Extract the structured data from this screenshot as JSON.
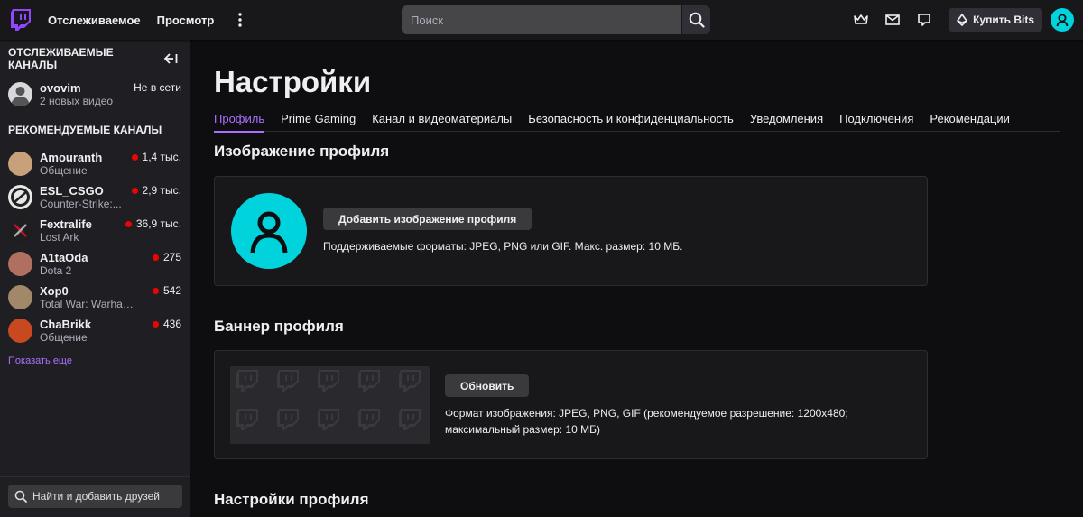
{
  "topnav": {
    "following": "Отслеживаемое",
    "browse": "Просмотр",
    "search_placeholder": "Поиск",
    "buy_bits": "Купить Bits"
  },
  "sidebar": {
    "followed_title": "ОТСЛЕЖИВАЕМЫЕ КАНАЛЫ",
    "followed": [
      {
        "name": "ovovim",
        "sub": "2 новых видео",
        "status": "Не в сети"
      }
    ],
    "recommended_title": "РЕКОМЕНДУЕМЫЕ КАНАЛЫ",
    "recommended": [
      {
        "name": "Amouranth",
        "game": "Общение",
        "viewers": "1,4 тыс.",
        "color": "#c8a07a"
      },
      {
        "name": "ESL_CSGO",
        "game": "Counter-Strike:...",
        "viewers": "2,9 тыс.",
        "color": "#e8e8e8"
      },
      {
        "name": "Fextralife",
        "game": "Lost Ark",
        "viewers": "36,9 тыс.",
        "color": "#2a2a2a"
      },
      {
        "name": "A1taOda",
        "game": "Dota 2",
        "viewers": "275",
        "color": "#b07060"
      },
      {
        "name": "Xop0",
        "game": "Total War: Warham...",
        "viewers": "542",
        "color": "#a08868"
      },
      {
        "name": "ChaBrikk",
        "game": "Общение",
        "viewers": "436",
        "color": "#c84820"
      }
    ],
    "show_more": "Показать еще",
    "find_friends": "Найти и добавить друзей"
  },
  "main": {
    "title": "Настройки",
    "tabs": [
      "Профиль",
      "Prime Gaming",
      "Канал и видеоматериалы",
      "Безопасность и конфиденциальность",
      "Уведомления",
      "Подключения",
      "Рекомендации"
    ],
    "profile_image": {
      "title": "Изображение профиля",
      "button": "Добавить изображение профиля",
      "hint": "Поддерживаемые форматы: JPEG, PNG или GIF. Макс. размер: 10 МБ."
    },
    "banner": {
      "title": "Баннер профиля",
      "button": "Обновить",
      "hint_line1": "Формат изображения: JPEG, PNG, GIF (рекомендуемое разрешение: 1200x480;",
      "hint_line2": "максимальный размер: 10 МБ)"
    },
    "profile_settings_title": "Настройки профиля"
  },
  "colors": {
    "accent": "#a970ff",
    "avatar": "#00d3db",
    "live": "#eb0400"
  }
}
